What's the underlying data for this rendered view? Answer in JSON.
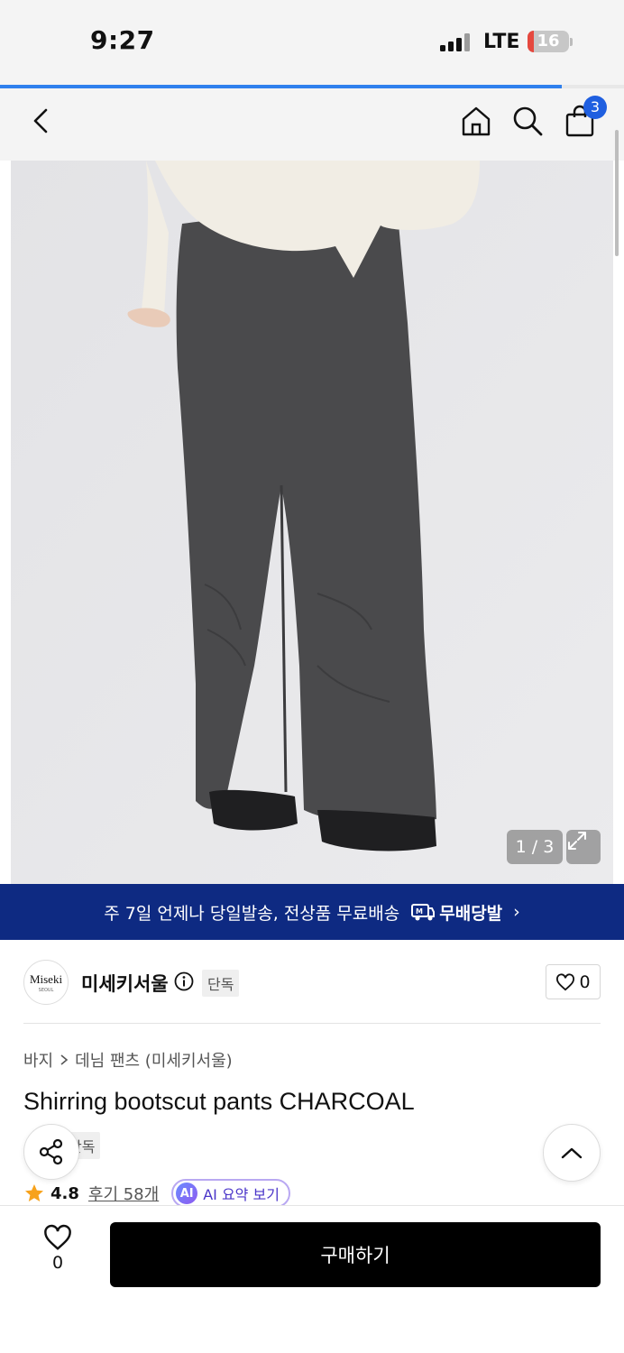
{
  "status_bar": {
    "time": "9:27",
    "network": "LTE",
    "battery": "16",
    "battery_level_percent": 16
  },
  "page_load_progress_percent": 90,
  "header": {
    "back_icon": "chevron-left-icon",
    "home_icon": "home-icon",
    "search_icon": "search-icon",
    "cart_icon": "shopping-bag-icon",
    "cart_count": "3"
  },
  "gallery": {
    "counter": "1 / 3",
    "expand_icon": "expand-icon"
  },
  "promo_banner": {
    "text": "주 7일 언제나 당일발송, 전상품 무료배송",
    "badge": "무배당발",
    "arrow": "›"
  },
  "brand": {
    "logo_text": "Miseki",
    "logo_subtext": "SEOUL",
    "name": "미세키서울",
    "tag": "단독",
    "like_count": "0"
  },
  "product": {
    "breadcrumb": [
      "바지",
      "데님 팬츠 (미세키서울)"
    ],
    "title": "Shirring bootscut pants CHARCOAL",
    "tag": "단독",
    "rating": "4.8",
    "review_link": "후기 58개",
    "ai_badge": "AI",
    "ai_summary": "AI 요약 보기"
  },
  "bottom_bar": {
    "wish_count": "0",
    "buy_label": "구매하기"
  },
  "colors": {
    "promo_bg": "#0e2a82",
    "accent_blue": "#1f5fe0",
    "buy_button": "#000000",
    "rating_star": "#f7a21b"
  }
}
